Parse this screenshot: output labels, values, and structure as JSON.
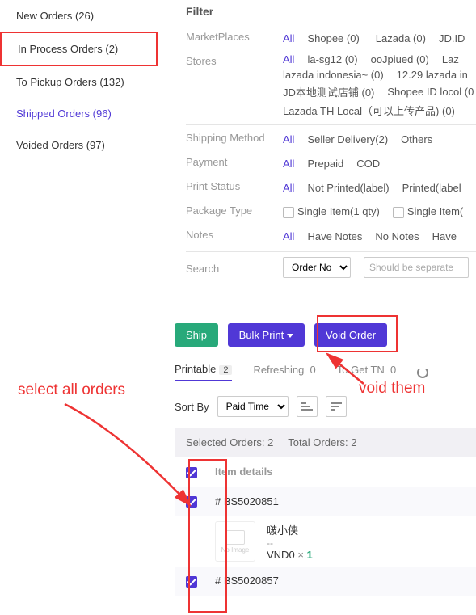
{
  "sidebar": {
    "items": [
      {
        "label": "New Orders (26)"
      },
      {
        "label": "In Process Orders (2)"
      },
      {
        "label": "To Pickup Orders (132)"
      },
      {
        "label": "Shipped Orders (96)"
      },
      {
        "label": "Voided Orders (97)"
      }
    ]
  },
  "filter": {
    "title": "Filter",
    "marketplaces": {
      "label": "MarketPlaces",
      "all": "All",
      "opts": [
        "Shopee (0)",
        "Lazada (0)",
        "JD.ID"
      ]
    },
    "stores": {
      "label": "Stores",
      "all": "All",
      "opts": [
        "la-sg12 (0)",
        "ooJpiued (0)",
        "Laz",
        "lazada indonesia~ (0)",
        "12.29 lazada in",
        "JD本地测试店铺 (0)",
        "Shopee ID locol (0",
        "Lazada TH Local（可以上传产品) (0)"
      ]
    },
    "shipping": {
      "label": "Shipping Method",
      "all": "All",
      "opts": [
        "Seller Delivery(2)",
        "Others"
      ]
    },
    "payment": {
      "label": "Payment",
      "all": "All",
      "opts": [
        "Prepaid",
        "COD"
      ]
    },
    "printstatus": {
      "label": "Print Status",
      "all": "All",
      "opts": [
        "Not Printed(label)",
        "Printed(label"
      ]
    },
    "packagetype": {
      "label": "Package Type",
      "opts": [
        "Single Item(1 qty)",
        "Single Item("
      ]
    },
    "notes": {
      "label": "Notes",
      "all": "All",
      "opts": [
        "Have Notes",
        "No Notes",
        "Have"
      ]
    },
    "search": {
      "label": "Search",
      "select": "Order No",
      "placeholder": "Should be separate"
    }
  },
  "toolbar": {
    "ship": "Ship",
    "bulkprint": "Bulk Print",
    "void": "Void Order"
  },
  "tabs": {
    "printable": {
      "label": "Printable",
      "count": "2"
    },
    "refreshing": {
      "label": "Refreshing",
      "count": "0"
    },
    "togettn": {
      "label": "To Get TN",
      "count": "0"
    }
  },
  "sort": {
    "label": "Sort By",
    "select": "Paid Time"
  },
  "status": {
    "selected": "Selected Orders: 2",
    "total": "Total Orders: 2"
  },
  "orders": {
    "header": "Item details",
    "item1": {
      "no": "# BS5020851",
      "name": "啵小侠",
      "dash": "--",
      "price": "VND0",
      "x": "×",
      "qty": "1"
    },
    "item2": {
      "no": "# BS5020857"
    }
  },
  "anno": {
    "a1": "select all orders",
    "a2": "void them"
  },
  "thumb_label": "No Image"
}
